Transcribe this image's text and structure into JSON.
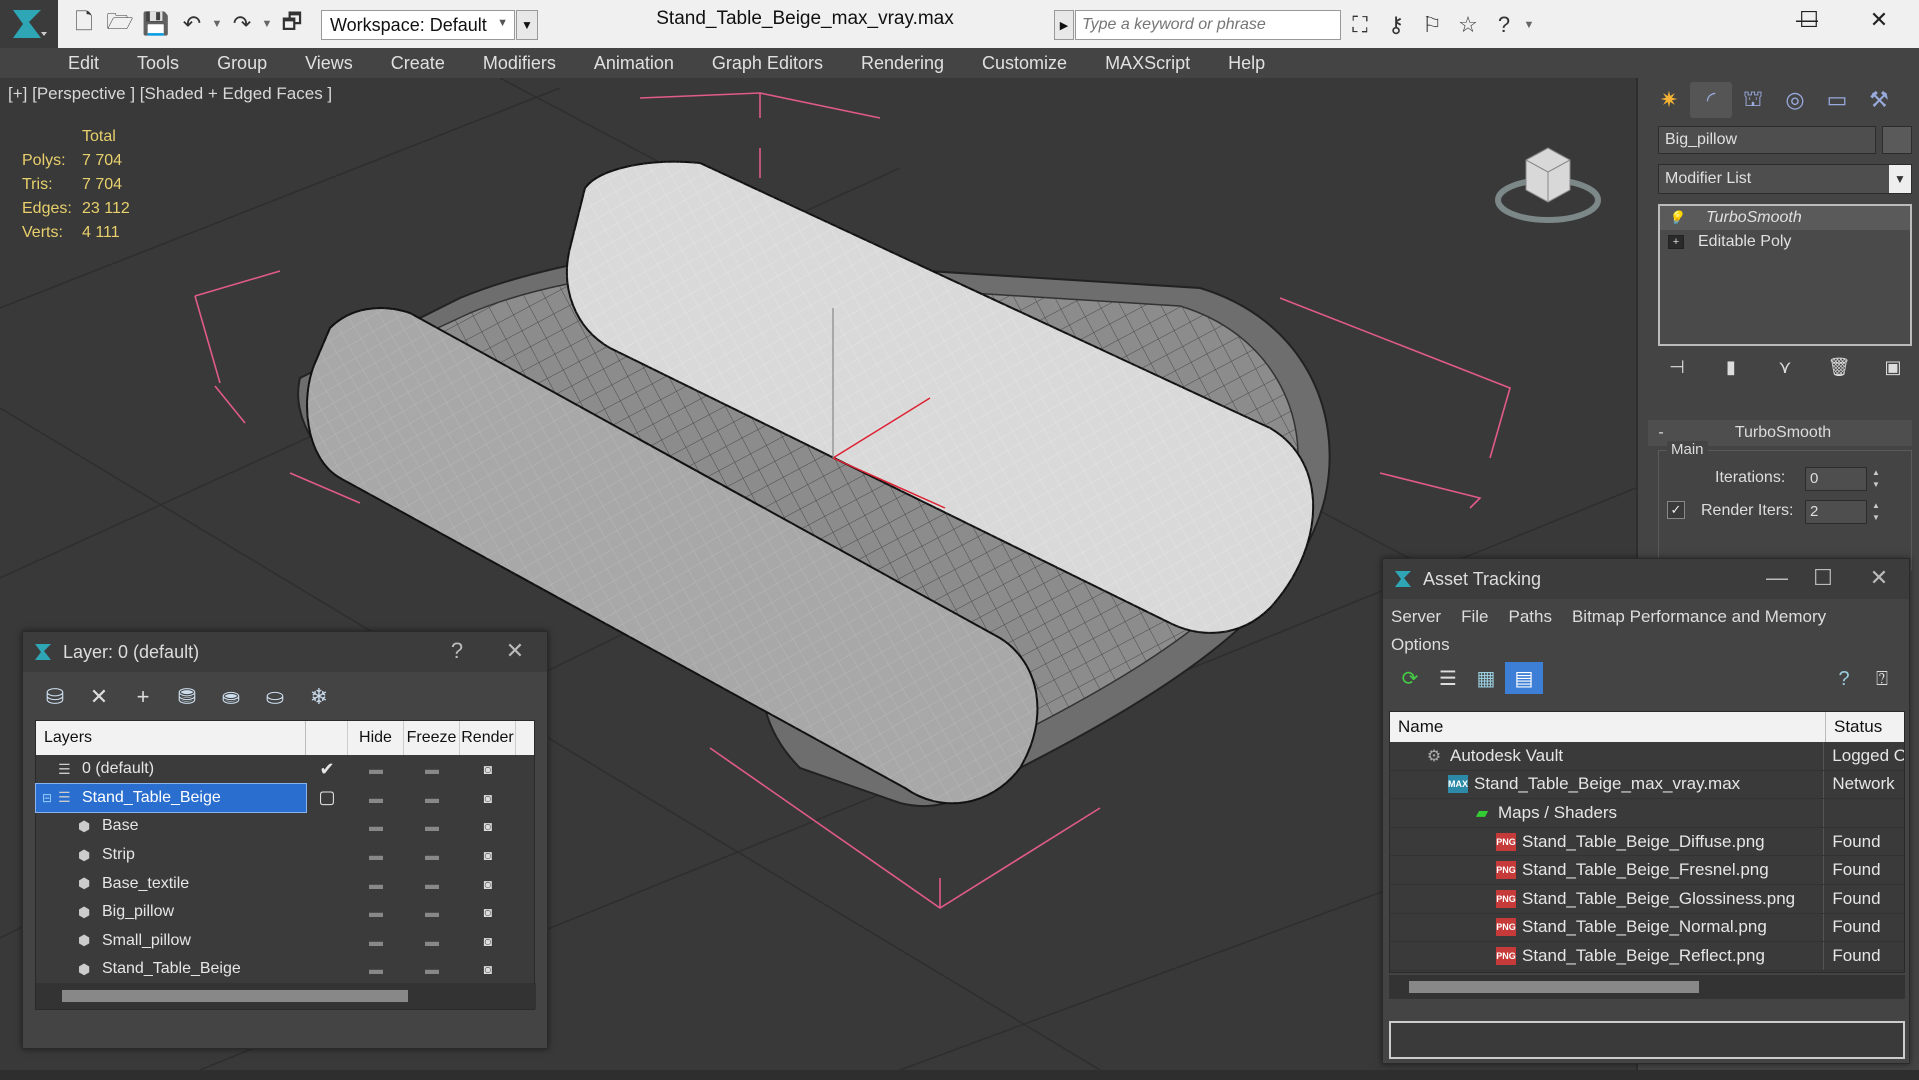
{
  "titlebar": {
    "workspace": "Workspace: Default",
    "doc_title": "Stand_Table_Beige_max_vray.max",
    "search_placeholder": "Type a keyword or phrase"
  },
  "menu": [
    "Edit",
    "Tools",
    "Group",
    "Views",
    "Create",
    "Modifiers",
    "Animation",
    "Graph Editors",
    "Rendering",
    "Customize",
    "MAXScript",
    "Help"
  ],
  "viewport": {
    "label": "[+] [Perspective ] [Shaded + Edged Faces ]",
    "stats": {
      "header": "Total",
      "rows": [
        {
          "k": "Polys:",
          "v": "7 704"
        },
        {
          "k": "Tris:",
          "v": "7 704"
        },
        {
          "k": "Edges:",
          "v": "23 112"
        },
        {
          "k": "Verts:",
          "v": "4 111"
        }
      ]
    }
  },
  "command_panel": {
    "object_name": "Big_pillow",
    "modifier_list": "Modifier List",
    "stack": [
      {
        "label": "TurboSmooth",
        "selected": true
      },
      {
        "label": "Editable Poly",
        "selected": false
      }
    ],
    "rollout_title": "TurboSmooth",
    "group_main": "Main",
    "iterations_label": "Iterations:",
    "iterations_value": "0",
    "render_iters_label": "Render Iters:",
    "render_iters_value": "2"
  },
  "layer_window": {
    "title": "Layer: 0 (default)",
    "help": "?",
    "columns": {
      "name": "Layers",
      "hide": "Hide",
      "freeze": "Freeze",
      "render": "Render"
    },
    "rows": [
      {
        "name": "0 (default)",
        "indent": 1,
        "type": "layer",
        "current": true,
        "selected": false
      },
      {
        "name": "Stand_Table_Beige",
        "indent": 1,
        "type": "layer",
        "current": false,
        "selected": true
      },
      {
        "name": "Base",
        "indent": 2,
        "type": "object",
        "current": false,
        "selected": false
      },
      {
        "name": "Strip",
        "indent": 2,
        "type": "object",
        "current": false,
        "selected": false
      },
      {
        "name": "Base_textile",
        "indent": 2,
        "type": "object",
        "current": false,
        "selected": false
      },
      {
        "name": "Big_pillow",
        "indent": 2,
        "type": "object",
        "current": false,
        "selected": false
      },
      {
        "name": "Small_pillow",
        "indent": 2,
        "type": "object",
        "current": false,
        "selected": false
      },
      {
        "name": "Stand_Table_Beige",
        "indent": 2,
        "type": "object",
        "current": false,
        "selected": false
      }
    ]
  },
  "asset_window": {
    "title": "Asset Tracking",
    "menu_row1": [
      "Server",
      "File",
      "Paths",
      "Bitmap Performance and Memory"
    ],
    "menu_row2": [
      "Options"
    ],
    "columns": {
      "name": "Name",
      "status": "Status"
    },
    "rows": [
      {
        "name": "Autodesk Vault",
        "indent": 1,
        "icon": "vault",
        "status": "Logged O"
      },
      {
        "name": "Stand_Table_Beige_max_vray.max",
        "indent": 2,
        "icon": "max",
        "status": "Network"
      },
      {
        "name": "Maps / Shaders",
        "indent": 3,
        "icon": "maps",
        "status": ""
      },
      {
        "name": "Stand_Table_Beige_Diffuse.png",
        "indent": 4,
        "icon": "png",
        "status": "Found"
      },
      {
        "name": "Stand_Table_Beige_Fresnel.png",
        "indent": 4,
        "icon": "png",
        "status": "Found"
      },
      {
        "name": "Stand_Table_Beige_Glossiness.png",
        "indent": 4,
        "icon": "png",
        "status": "Found"
      },
      {
        "name": "Stand_Table_Beige_Normal.png",
        "indent": 4,
        "icon": "png",
        "status": "Found"
      },
      {
        "name": "Stand_Table_Beige_Reflect.png",
        "indent": 4,
        "icon": "png",
        "status": "Found"
      }
    ]
  },
  "colors": {
    "accent": "#2a6fcf",
    "stats": "#e8d06c",
    "viewport_bg": "#393939"
  }
}
